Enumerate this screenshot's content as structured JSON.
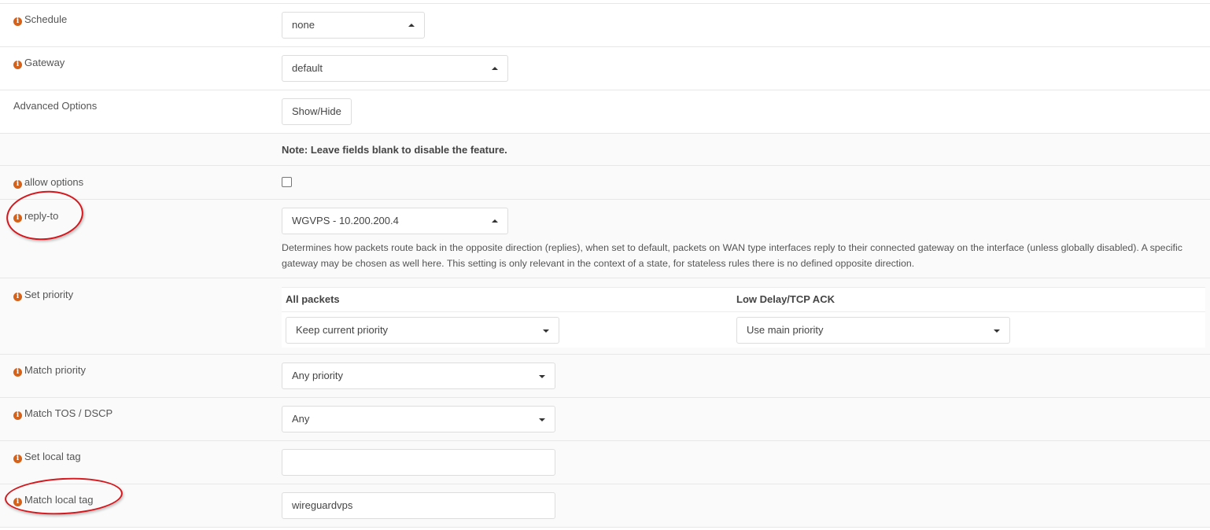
{
  "rows": {
    "schedule": {
      "label": "Schedule",
      "value": "none"
    },
    "gateway": {
      "label": "Gateway",
      "value": "default"
    },
    "advanced": {
      "label": "Advanced Options",
      "button": "Show/Hide"
    },
    "note": {
      "text": "Note: Leave fields blank to disable the feature."
    },
    "allow_options": {
      "label": "allow options",
      "checked": false
    },
    "reply_to": {
      "label": "reply-to",
      "value": "WGVPS - 10.200.200.4",
      "help": "Determines how packets route back in the opposite direction (replies), when set to default, packets on WAN type interfaces reply to their connected gateway on the interface (unless globally disabled). A specific gateway may be chosen as well here. This setting is only relevant in the context of a state, for stateless rules there is no defined opposite direction."
    },
    "set_priority": {
      "label": "Set priority",
      "col1_header": "All packets",
      "col1_value": "Keep current priority",
      "col2_header": "Low Delay/TCP ACK",
      "col2_value": "Use main priority"
    },
    "match_priority": {
      "label": "Match priority",
      "value": "Any priority"
    },
    "match_tos": {
      "label": "Match TOS / DSCP",
      "value": "Any"
    },
    "set_local_tag": {
      "label": "Set local tag",
      "value": ""
    },
    "match_local_tag": {
      "label": "Match local tag",
      "value": "wireguardvps"
    }
  },
  "icons": {
    "info": "i"
  },
  "colors": {
    "info_icon": "#d4621a",
    "annotation": "#d6161b"
  }
}
